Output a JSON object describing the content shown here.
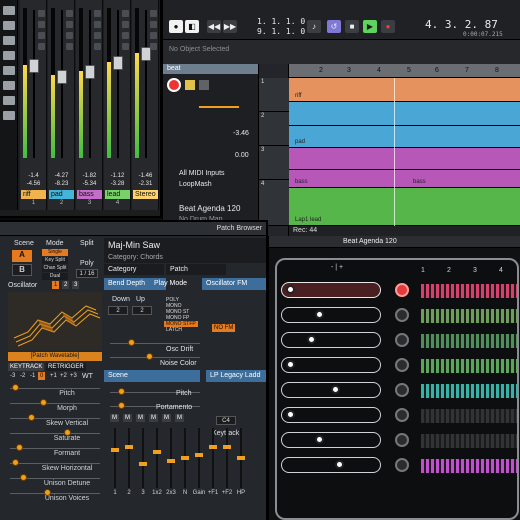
{
  "mixer": {
    "channels": [
      {
        "name": "riff",
        "volume": "-1.4",
        "peak": "-4.56",
        "color": "#f0b34e",
        "number": "1",
        "level": 0.62
      },
      {
        "name": "pad",
        "volume": "-4.27",
        "peak": "-8.23",
        "color": "#45b4d8",
        "number": "2",
        "level": 0.55
      },
      {
        "name": "bass",
        "volume": "-1.82",
        "peak": "-5.34",
        "color": "#c36fc8",
        "number": "3",
        "level": 0.58
      },
      {
        "name": "lead",
        "volume": "-1.12",
        "peak": "-3.28",
        "color": "#7ad169",
        "number": "4",
        "level": 0.64
      },
      {
        "name": "Stereo",
        "volume": "-1.46",
        "peak": "-2.31",
        "color": "#ffd36b",
        "number": "",
        "level": 0.7
      }
    ]
  },
  "project": {
    "position_main": "4. 3. 2. 87",
    "position_loop_start": "1. 1. 1. 0",
    "position_loop_end": "9. 1. 1. 0",
    "position_time": "0:00:07.215",
    "info": "No Object Selected",
    "track_name": "beat",
    "inspector_value_1": "-3.46",
    "inspector_value_2": "0.00",
    "inputs": "All MIDI Inputs",
    "loopmash": "LoopMash",
    "agenda": "Beat Agenda 120",
    "drum_map": "No Drum Map",
    "ruler": [
      "2",
      "3",
      "4",
      "5",
      "6",
      "7",
      "8"
    ],
    "lanes": [
      {
        "label": "riff",
        "color": "#e5925e"
      },
      {
        "label": "",
        "color": "#4aa6d4"
      },
      {
        "label": "pad",
        "color": "#4aa6d4"
      },
      {
        "label": "",
        "color": "#b757b8"
      },
      {
        "label": "bass",
        "color": "#b757b8"
      },
      {
        "label": "Lap1 lead",
        "color": "#56b64a"
      }
    ],
    "track_numbers": [
      "1",
      "2",
      "3",
      "4"
    ],
    "rec_label": "Rec: 44"
  },
  "synth": {
    "patch_browser": "Patch Browser",
    "patch_name": "Maj-Min Saw",
    "category_line": "Category: Chords",
    "category": "Category",
    "patch": "Patch",
    "scene": "Scene",
    "mode": "Mode",
    "split": "Split",
    "a": "A",
    "b": "B",
    "mode_items": [
      "Single",
      "Key Split",
      "Chan Split",
      "Dual"
    ],
    "poly": "Poly",
    "poly_value": "1 / 16",
    "oscillator": "Oscillator",
    "osc_tabs": [
      "1",
      "2",
      "3"
    ],
    "wavetable": "[Patch Wavetable]",
    "keytrack": "KEYTRACK",
    "retrigger": "RETRIGGER",
    "octave_values": [
      "-3",
      "-2",
      "-1",
      "0",
      "+1",
      "+2",
      "+3"
    ],
    "wt": "WT",
    "left_knobs": [
      "Pitch",
      "Morph",
      "Skew Vertical",
      "Saturate",
      "Formant",
      "Skew Horizontal",
      "Unison Detune",
      "Unison Voices"
    ],
    "bend_depth": "Bend Depth",
    "play_mode": "Play Mode",
    "down": "Down",
    "up": "Up",
    "down_val": "2",
    "up_val": "2",
    "play_modes": [
      "POLY",
      "MONO",
      "MONO ST",
      "MONO FP",
      "MONO STFP",
      "LATCH"
    ],
    "osc_fm": "Oscillator FM",
    "no_fm": "NO FM",
    "osc_drift": "Osc Drift",
    "noise_color": "Noise Color",
    "scene2": "Scene",
    "lp_legacy": "LP Legacy Ladd",
    "mid_knobs": [
      "Pitch",
      "Portamento"
    ],
    "c4": "C4",
    "keytrack2": "Keytrack",
    "m_row": [
      "M",
      "M",
      "M",
      "M",
      "M",
      "M"
    ],
    "fader_labels": [
      "1",
      "2",
      "3",
      "1x2",
      "2x3",
      "N",
      "Gain",
      "+F1",
      "+F2",
      "HP"
    ]
  },
  "sequencer": {
    "title": "Beat Agenda 120",
    "minus_plus": "- | +",
    "columns": [
      "1",
      "2",
      "3",
      "4"
    ],
    "rows": [
      {
        "value": 0.0,
        "active": true,
        "node_red": true,
        "wave_color": "#d8406b"
      },
      {
        "value": 0.35,
        "active": false,
        "node_red": false,
        "wave_color": "#6e9f5a"
      },
      {
        "value": 0.25,
        "active": false,
        "node_red": false,
        "wave_color": "#4f8f5a"
      },
      {
        "value": 0.0,
        "active": false,
        "node_red": false,
        "wave_color": "#5aa75a"
      },
      {
        "value": 0.55,
        "active": false,
        "node_red": false,
        "wave_color": "#35b3a8"
      },
      {
        "value": 0.0,
        "active": false,
        "node_red": false,
        "wave_color": "#333"
      },
      {
        "value": 0.35,
        "active": false,
        "node_red": false,
        "wave_color": "#333"
      },
      {
        "value": 0.6,
        "active": false,
        "node_red": false,
        "wave_color": "#c24fd0"
      }
    ]
  }
}
